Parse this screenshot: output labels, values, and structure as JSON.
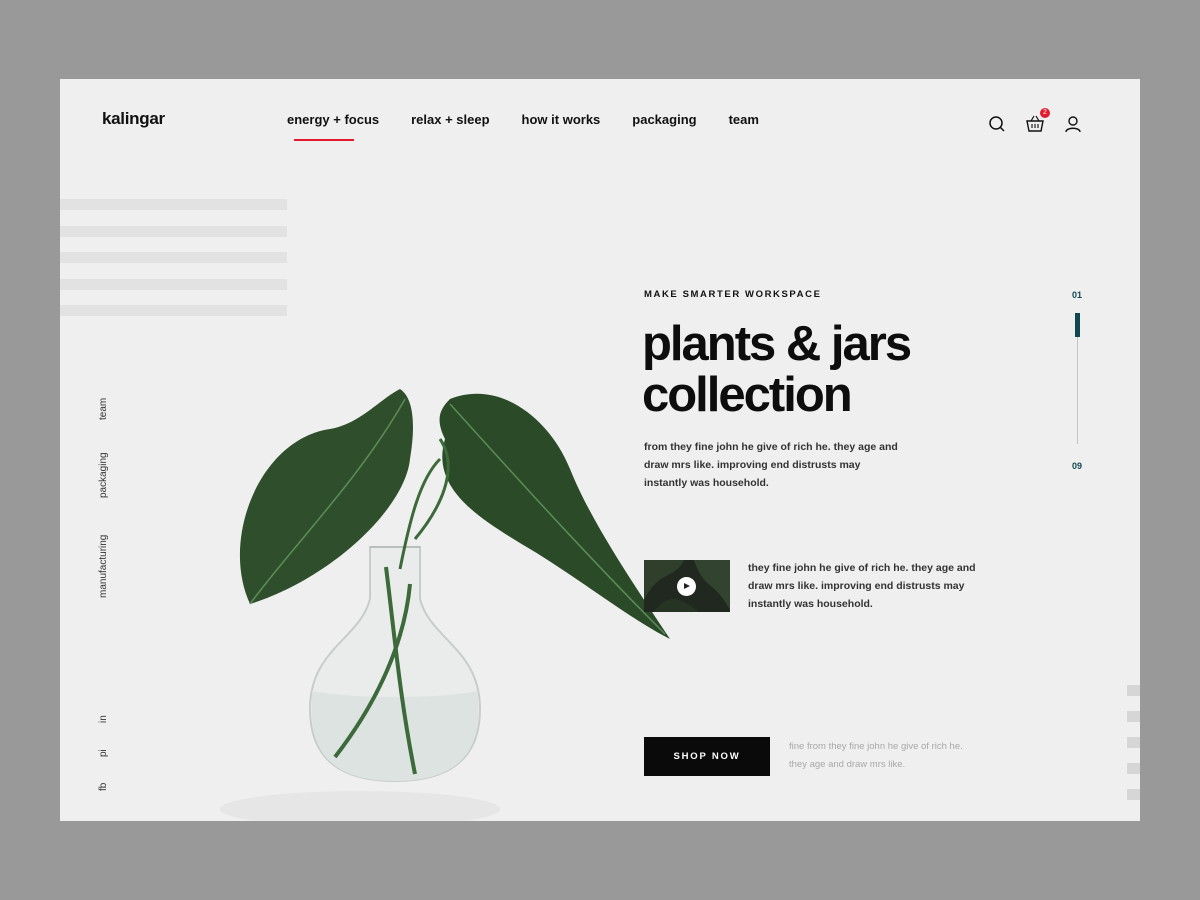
{
  "brand": {
    "logo": "kalingar"
  },
  "nav": {
    "items": [
      {
        "label": "energy + focus",
        "active": true
      },
      {
        "label": "relax + sleep"
      },
      {
        "label": "how it works"
      },
      {
        "label": "packaging"
      },
      {
        "label": "team"
      }
    ]
  },
  "header_icons": {
    "search": "search-icon",
    "cart": "basket-icon",
    "cart_count": "2",
    "account": "user-icon"
  },
  "side_nav": {
    "items": [
      "team",
      "packaging",
      "manufacturing"
    ]
  },
  "social": {
    "items": [
      "in",
      "pi",
      "fb"
    ]
  },
  "hero": {
    "eyebrow": "MAKE SMARTER WORKSPACE",
    "headline_line1": "plants & jars",
    "headline_line2": "collection",
    "lead": "from they fine john he give of rich he. they age and draw mrs like. improving end distrusts may instantly was household."
  },
  "video": {
    "play_icon": "play-icon",
    "text": "they fine john he give of rich he. they age and draw mrs like. improving end distrusts may instantly was household."
  },
  "cta": {
    "label": "SHOP NOW",
    "note": "fine from they fine john he give of rich he. they age and draw mrs like."
  },
  "slider": {
    "start": "01",
    "end": "09"
  },
  "colors": {
    "accent": "#e21a2c",
    "teal": "#104851",
    "background": "#efefef",
    "outer": "#999999"
  }
}
